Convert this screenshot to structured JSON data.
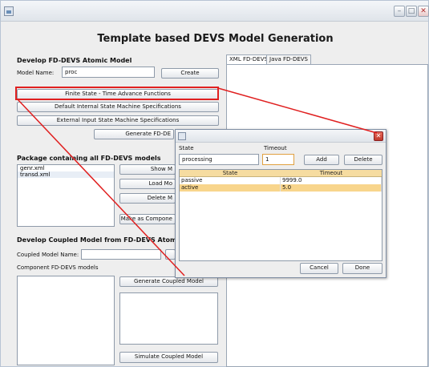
{
  "window": {
    "title": "",
    "controls": [
      "minimize-icon",
      "maximize-icon",
      "close-icon"
    ]
  },
  "heading": "Template based DEVS Model Generation",
  "atomic": {
    "section_title": "Develop FD-DEVS Atomic Model",
    "model_name_label": "Model Name:",
    "model_name_value": "proc",
    "create_label": "Create",
    "finite_state_label": "Finite State - Time Advance Functions",
    "default_internal_label": "Default Internal State Machine Specifications",
    "external_input_label": "External Input State Machine Specifications",
    "generate_label": "Generate FD-DE"
  },
  "package": {
    "section_title": "Package containing all FD-DEVS models",
    "files": [
      "genr.xml",
      "transd.xml"
    ],
    "show_label": "Show M",
    "load_label": "Load Mo",
    "delete_label": "Delete M",
    "make_component_label": "Make as Compone"
  },
  "coupled": {
    "section_title": "Develop Coupled Model from FD-DEVS Atomic M",
    "name_label": "Coupled Model Name:",
    "name_value": "",
    "components_label": "Component FD-DEVS models",
    "generate_coupled_label": "Generate Coupled Model",
    "simulate_label": "Simulate Coupled Model"
  },
  "tabs": [
    {
      "label": "XML FD-DEVS",
      "active": true
    },
    {
      "label": "Java FD-DEVS",
      "active": false
    }
  ],
  "dialog": {
    "state_label": "State",
    "timeout_label": "Timeout",
    "state_value": "processing",
    "timeout_value": "1",
    "add_label": "Add",
    "delete_label": "Delete",
    "columns": [
      "State",
      "Timeout"
    ],
    "rows": [
      {
        "state": "passive",
        "timeout": "9999.0",
        "selected": false
      },
      {
        "state": "active",
        "timeout": "5.0",
        "selected": true
      }
    ],
    "cancel_label": "Cancel",
    "done_label": "Done"
  },
  "colors": {
    "highlight_red": "#e02020",
    "selection": "#f8d58c",
    "table_header": "#f6dca0"
  }
}
